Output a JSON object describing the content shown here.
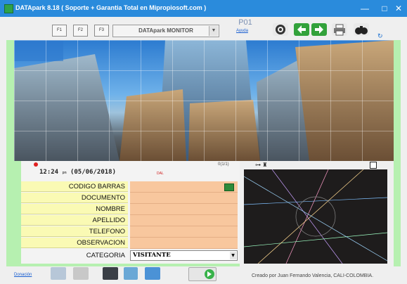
{
  "window": {
    "title": "DATApark 8.18  ( Soporte + Garantia Total en Mipropiosoft.com )",
    "minimize": "—",
    "maximize": "□",
    "close": "✕"
  },
  "toolbar": {
    "f_buttons": [
      "F1",
      "F2",
      "F3"
    ],
    "monitor_select": "DATApark MONITOR",
    "station": "P01",
    "help_link": "Ayuda",
    "icons": [
      "camera-icon",
      "back-arrow-icon",
      "forward-arrow-icon",
      "printer-icon",
      "binoculars-icon"
    ]
  },
  "status": {
    "time": "12:24",
    "ampm": "pm",
    "date": "(05/06/2018)",
    "counter": "0(1/1)",
    "dal": "DAL"
  },
  "form": {
    "fields": [
      {
        "label": "CODIGO BARRAS",
        "value": ""
      },
      {
        "label": "DOCUMENTO",
        "value": ""
      },
      {
        "label": "NOMBRE",
        "value": ""
      },
      {
        "label": "APELLIDO",
        "value": ""
      },
      {
        "label": "TELEFONO",
        "value": ""
      },
      {
        "label": "OBSERVACION",
        "value": ""
      }
    ],
    "category_label": "CATEGORIA",
    "category_value": "VISITANTE"
  },
  "footer": {
    "donation_link": "Donación",
    "credit": "Creado por Juan Fernando Valencia, CALI-COLOMBIA."
  },
  "colors": {
    "titlebar": "#2a8bdc",
    "frame_green": "#b6f0b0",
    "label_yellow": "#fafab4",
    "field_orange": "#f8c79e"
  }
}
